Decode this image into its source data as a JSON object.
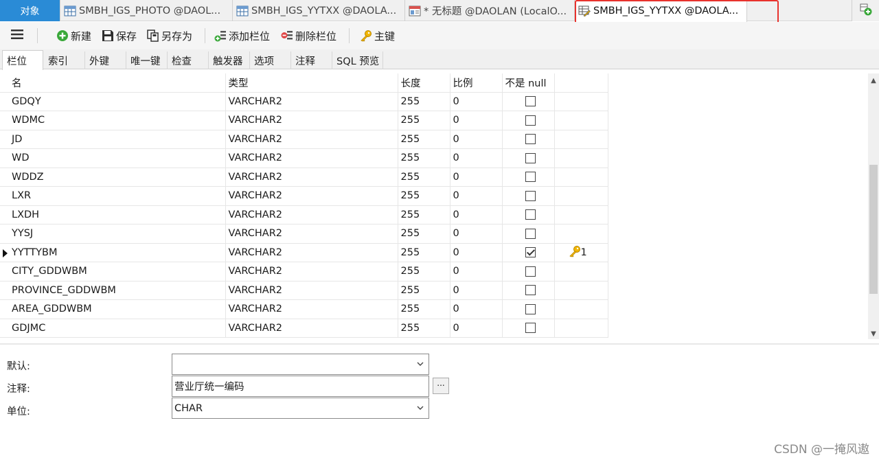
{
  "tabs": [
    {
      "label": "对象",
      "icon": "none"
    },
    {
      "label": "SMBH_IGS_PHOTO @DAOL...",
      "icon": "table-icon"
    },
    {
      "label": "SMBH_IGS_YYTXX @DAOLA...",
      "icon": "table-icon"
    },
    {
      "label": "* 无标题 @DAOLAN (LocalO...",
      "icon": "query-icon"
    },
    {
      "label": "SMBH_IGS_YYTXX @DAOLA...",
      "icon": "table-design-icon",
      "active": true
    }
  ],
  "toolbar": {
    "new": "新建",
    "save": "保存",
    "save_as": "另存为",
    "add_field": "添加栏位",
    "delete_field": "删除栏位",
    "primary_key": "主键"
  },
  "subtabs": [
    "栏位",
    "索引",
    "外键",
    "唯一键",
    "检查",
    "触发器",
    "选项",
    "注释",
    "SQL 预览"
  ],
  "grid": {
    "headers": [
      "名",
      "类型",
      "长度",
      "比例",
      "不是 null",
      ""
    ],
    "rows": [
      {
        "name": "GDQY",
        "type": "VARCHAR2",
        "length": "255",
        "scale": "0",
        "not_null": false,
        "key": ""
      },
      {
        "name": "WDMC",
        "type": "VARCHAR2",
        "length": "255",
        "scale": "0",
        "not_null": false,
        "key": ""
      },
      {
        "name": "JD",
        "type": "VARCHAR2",
        "length": "255",
        "scale": "0",
        "not_null": false,
        "key": ""
      },
      {
        "name": "WD",
        "type": "VARCHAR2",
        "length": "255",
        "scale": "0",
        "not_null": false,
        "key": ""
      },
      {
        "name": "WDDZ",
        "type": "VARCHAR2",
        "length": "255",
        "scale": "0",
        "not_null": false,
        "key": ""
      },
      {
        "name": "LXR",
        "type": "VARCHAR2",
        "length": "255",
        "scale": "0",
        "not_null": false,
        "key": ""
      },
      {
        "name": "LXDH",
        "type": "VARCHAR2",
        "length": "255",
        "scale": "0",
        "not_null": false,
        "key": ""
      },
      {
        "name": "YYSJ",
        "type": "VARCHAR2",
        "length": "255",
        "scale": "0",
        "not_null": false,
        "key": ""
      },
      {
        "name": "YYTTYBM",
        "type": "VARCHAR2",
        "length": "255",
        "scale": "0",
        "not_null": true,
        "key": "1",
        "selected": true
      },
      {
        "name": "CITY_GDDWBM",
        "type": "VARCHAR2",
        "length": "255",
        "scale": "0",
        "not_null": false,
        "key": ""
      },
      {
        "name": "PROVINCE_GDDWBM",
        "type": "VARCHAR2",
        "length": "255",
        "scale": "0",
        "not_null": false,
        "key": ""
      },
      {
        "name": "AREA_GDDWBM",
        "type": "VARCHAR2",
        "length": "255",
        "scale": "0",
        "not_null": false,
        "key": ""
      },
      {
        "name": "GDJMC",
        "type": "VARCHAR2",
        "length": "255",
        "scale": "0",
        "not_null": false,
        "key": ""
      }
    ]
  },
  "props": {
    "default_label": "默认:",
    "default_value": "",
    "comment_label": "注释:",
    "comment_value": "营业厅统一编码",
    "unit_label": "单位:",
    "unit_value": "CHAR"
  },
  "watermark": "CSDN @一掩风遨",
  "colors": {
    "accent": "#2a8bd6",
    "highlight": "#e8322d"
  }
}
